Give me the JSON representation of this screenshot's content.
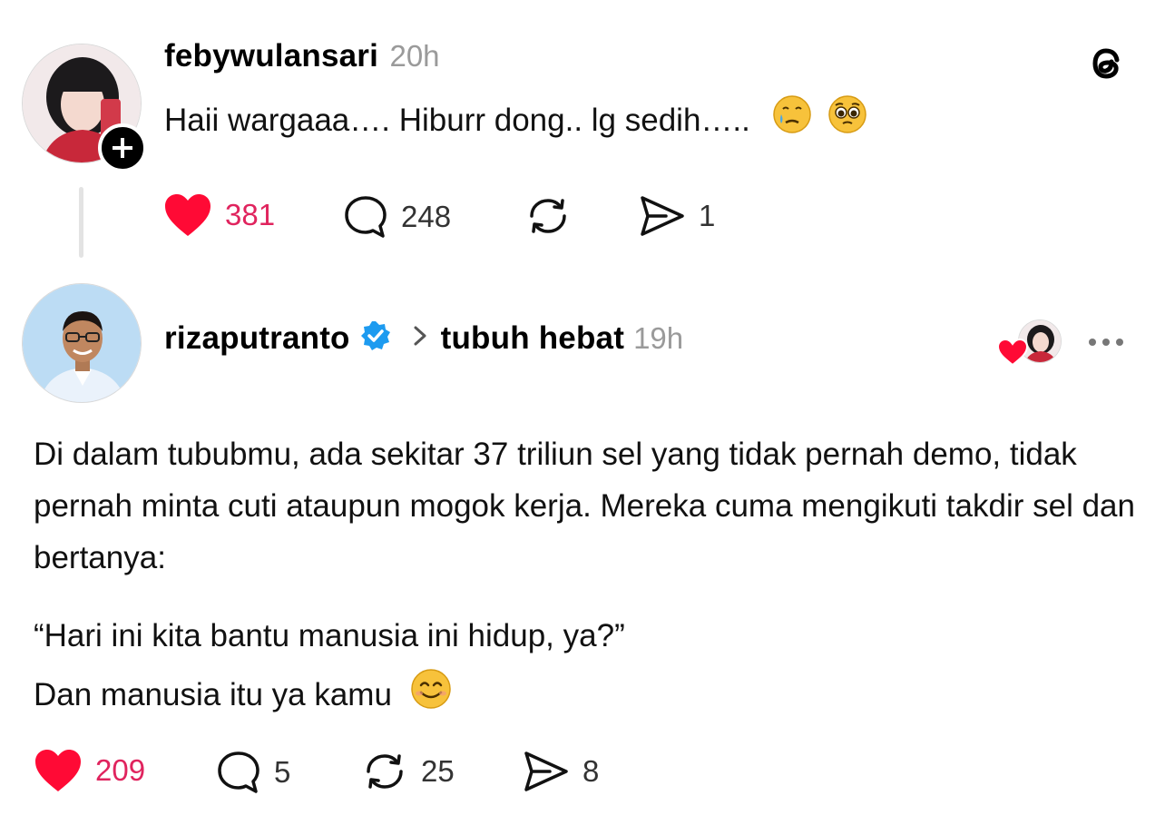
{
  "post1": {
    "username": "febywulansari",
    "time": "20h",
    "text": "Haii wargaaa…. Hiburr dong.. lg sedih…..",
    "emojis": [
      "crying-face",
      "pleading-face"
    ],
    "likes": "381",
    "replies": "248",
    "shares": "1"
  },
  "post2": {
    "username": "rizaputranto",
    "topic": "tubuh hebat",
    "time": "19h",
    "paragraph1": "Di dalam tububmu, ada sekitar 37 triliun sel yang tidak pernah demo, tidak pernah minta cuti ataupun mogok kerja. Mereka cuma mengikuti takdir sel dan bertanya:",
    "quote": "“Hari ini kita bantu manusia ini hidup, ya?”",
    "closing": "Dan manusia itu ya kamu",
    "closing_emoji": "smiling-face",
    "likes": "209",
    "replies": "5",
    "reposts": "25",
    "shares": "8"
  },
  "colors": {
    "like_red": "#e0245e",
    "verified_blue": "#1d9bf0",
    "muted_gray": "#9a9a9a"
  }
}
